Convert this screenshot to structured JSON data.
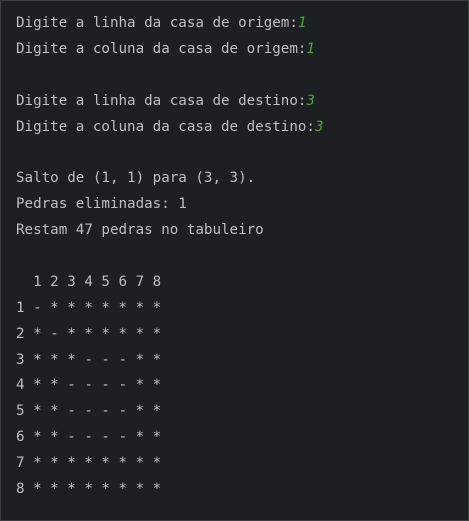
{
  "colors": {
    "background": "#1e1f22",
    "text": "#bcbec4",
    "user_input": "#46a336"
  },
  "console": {
    "lines": [
      {
        "prompt": "Digite a linha da casa de origem:",
        "input": "1"
      },
      {
        "prompt": "Digite a coluna da casa de origem:",
        "input": "1"
      },
      {
        "prompt": "",
        "input": ""
      },
      {
        "prompt": "Digite a linha da casa de destino:",
        "input": "3"
      },
      {
        "prompt": "Digite a coluna da casa de destino:",
        "input": "3"
      },
      {
        "prompt": "",
        "input": ""
      },
      {
        "prompt": "Salto de (1, 1) para (3, 3).",
        "input": ""
      },
      {
        "prompt": "Pedras eliminadas: 1",
        "input": ""
      },
      {
        "prompt": "Restam 47 pedras no tabuleiro",
        "input": ""
      },
      {
        "prompt": "",
        "input": ""
      },
      {
        "prompt": "  1 2 3 4 5 6 7 8",
        "input": ""
      },
      {
        "prompt": "1 - * * * * * * *",
        "input": ""
      },
      {
        "prompt": "2 * - * * * * * *",
        "input": ""
      },
      {
        "prompt": "3 * * * - - - * *",
        "input": ""
      },
      {
        "prompt": "4 * * - - - - * *",
        "input": ""
      },
      {
        "prompt": "5 * * - - - - * *",
        "input": ""
      },
      {
        "prompt": "6 * * - - - - * *",
        "input": ""
      },
      {
        "prompt": "7 * * * * * * * *",
        "input": ""
      },
      {
        "prompt": "8 * * * * * * * *",
        "input": ""
      }
    ]
  }
}
